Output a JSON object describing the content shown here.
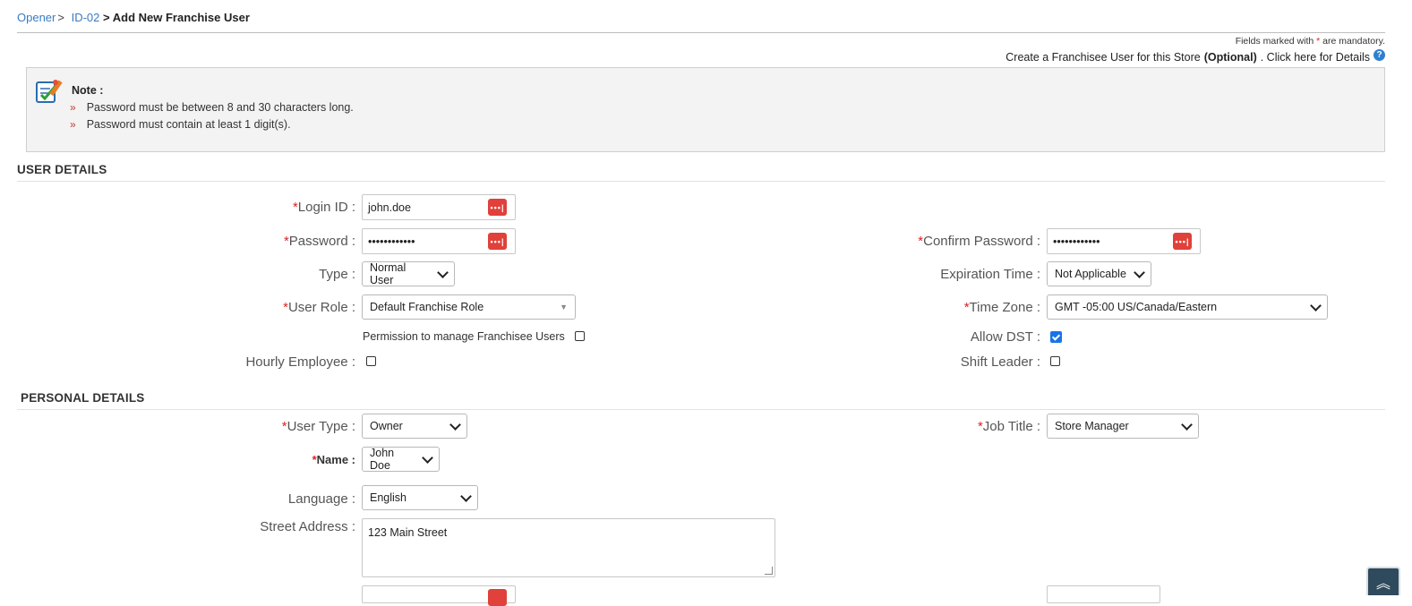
{
  "breadcrumb": {
    "item1": "Opener",
    "item2": "ID-02",
    "current": "> Add New Franchise User"
  },
  "header": {
    "mandatory_prefix": "Fields marked with",
    "mandatory_star": "*",
    "mandatory_suffix": "are mandatory.",
    "create_prefix": "Create a Franchisee User for this Store",
    "create_optional": "(Optional)",
    "create_suffix": ". Click here for Details"
  },
  "note": {
    "title": "Note :",
    "items": [
      "Password must be between 8 and 30 characters long.",
      "Password must contain at least 1 digit(s)."
    ]
  },
  "user_details": {
    "title": "USER DETAILS",
    "login_id": {
      "label": "Login ID :",
      "value": "john.doe"
    },
    "password": {
      "label": "Password :",
      "value": "••••••••••••"
    },
    "confirm_password": {
      "label": "Confirm Password :",
      "value": "••••••••••••"
    },
    "type": {
      "label": "Type :",
      "value": "Normal User"
    },
    "expiration": {
      "label": "Expiration Time :",
      "value": "Not Applicable"
    },
    "user_role": {
      "label": "User Role :",
      "value": "Default Franchise Role"
    },
    "time_zone": {
      "label": "Time Zone :",
      "value": "GMT -05:00 US/Canada/Eastern"
    },
    "permission": {
      "label": "Permission to manage Franchisee Users",
      "checked": false
    },
    "allow_dst": {
      "label": "Allow DST :",
      "checked": true
    },
    "hourly_employee": {
      "label": "Hourly Employee :",
      "checked": false
    },
    "shift_leader": {
      "label": "Shift Leader :",
      "checked": false
    }
  },
  "personal_details": {
    "title": "PERSONAL DETAILS",
    "user_type": {
      "label": "User Type :",
      "value": "Owner"
    },
    "job_title": {
      "label": "Job Title :",
      "value": "Store Manager"
    },
    "name": {
      "label": "Name :",
      "value": "John Doe"
    },
    "language": {
      "label": "Language :",
      "value": "English"
    },
    "street_address": {
      "label": "Street Address :",
      "value": "123 Main Street"
    }
  },
  "required_star": "*",
  "colors": {
    "link": "#3a7bbf",
    "required": "#dd2222",
    "password_icon": "#e0413a",
    "checkbox_checked": "#1a73e8"
  },
  "icons": [
    "note-clipboard-icon",
    "help-icon",
    "password-manager-icon",
    "chevron-down-icon",
    "scroll-top-icon"
  ]
}
